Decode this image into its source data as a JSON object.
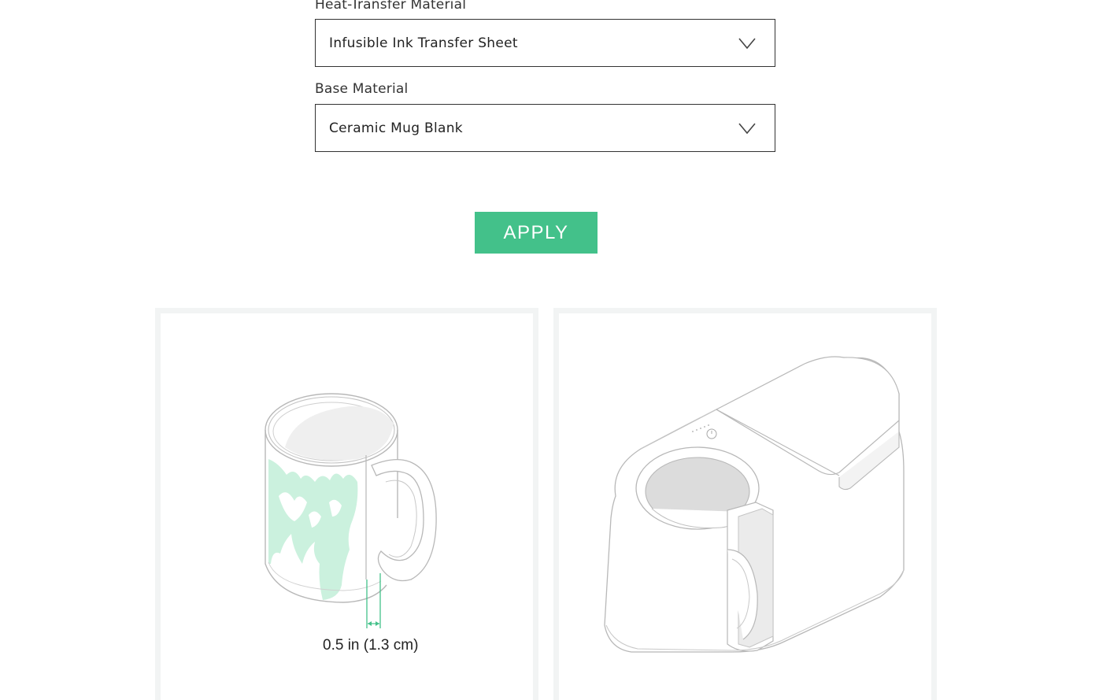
{
  "form": {
    "heat_transfer_label": "Heat-Transfer Material",
    "heat_transfer_value": "Infusible Ink Transfer Sheet",
    "base_label": "Base Material",
    "base_value": "Ceramic Mug Blank",
    "apply_label": "APPLY"
  },
  "illustrations": {
    "mug_measurement": "0.5 in (1.3 cm)"
  },
  "colors": {
    "accent": "#43c18a",
    "card_border": "#f2f4f4",
    "design_tint": "#c8f0dc",
    "line": "#b8b8b8"
  },
  "icons": [
    "chevron-down-icon",
    "power-icon"
  ]
}
